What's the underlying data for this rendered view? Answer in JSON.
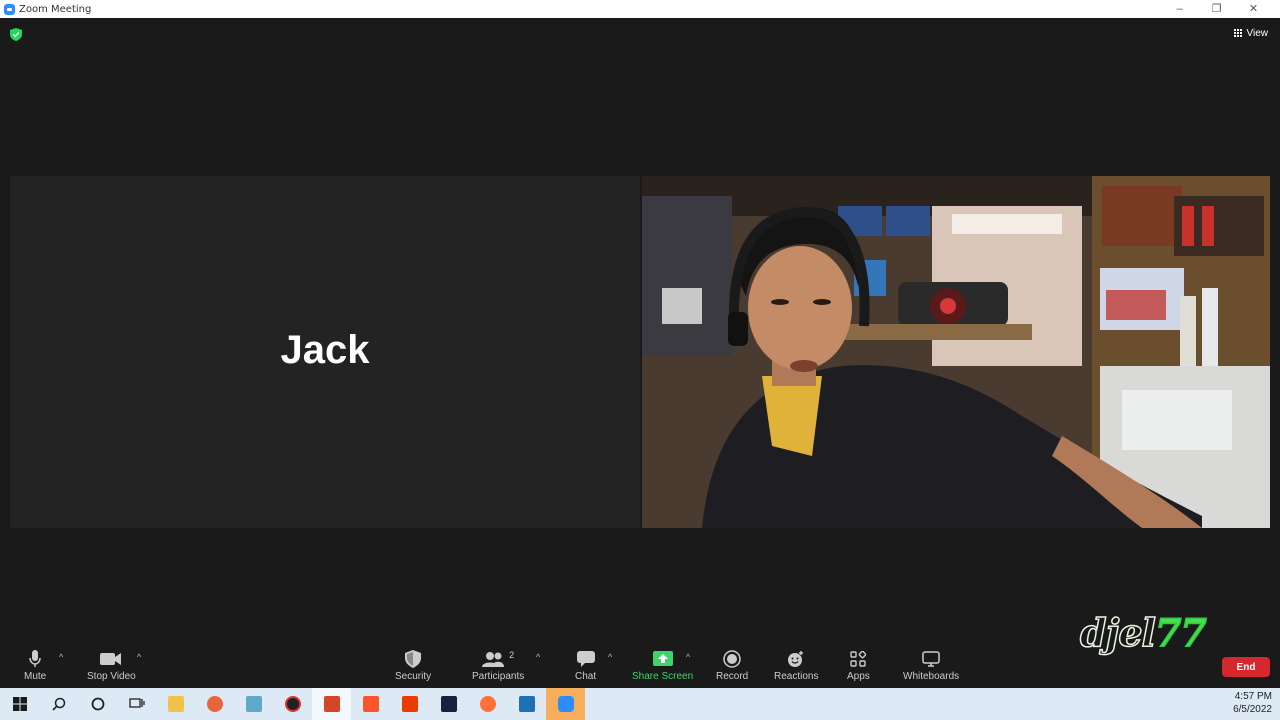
{
  "window": {
    "title": "Zoom Meeting"
  },
  "meeting": {
    "view_label": "View",
    "participant_name": "Jack"
  },
  "toolbar": {
    "mute": "Mute",
    "stop_video": "Stop Video",
    "security": "Security",
    "participants": "Participants",
    "participants_count": "2",
    "chat": "Chat",
    "share_screen": "Share Screen",
    "record": "Record",
    "reactions": "Reactions",
    "apps": "Apps",
    "whiteboards": "Whiteboards",
    "end": "End"
  },
  "watermark": {
    "text": "djel",
    "suffix": "77"
  },
  "taskbar": {
    "icons": [
      "windows-start-icon",
      "search-icon",
      "cortana-icon",
      "task-view-icon",
      "file-explorer-icon",
      "app-icon",
      "app-icon",
      "app-icon",
      "powerpoint-icon",
      "brave-icon",
      "office-icon",
      "app-icon",
      "firefox-icon",
      "photos-icon",
      "zoom-icon"
    ],
    "time": "4:57 PM",
    "date": "6/5/2022"
  },
  "colors": {
    "share_green": "#3ed36b",
    "end_red": "#d4272e",
    "zoom_blue": "#2d8cff"
  }
}
